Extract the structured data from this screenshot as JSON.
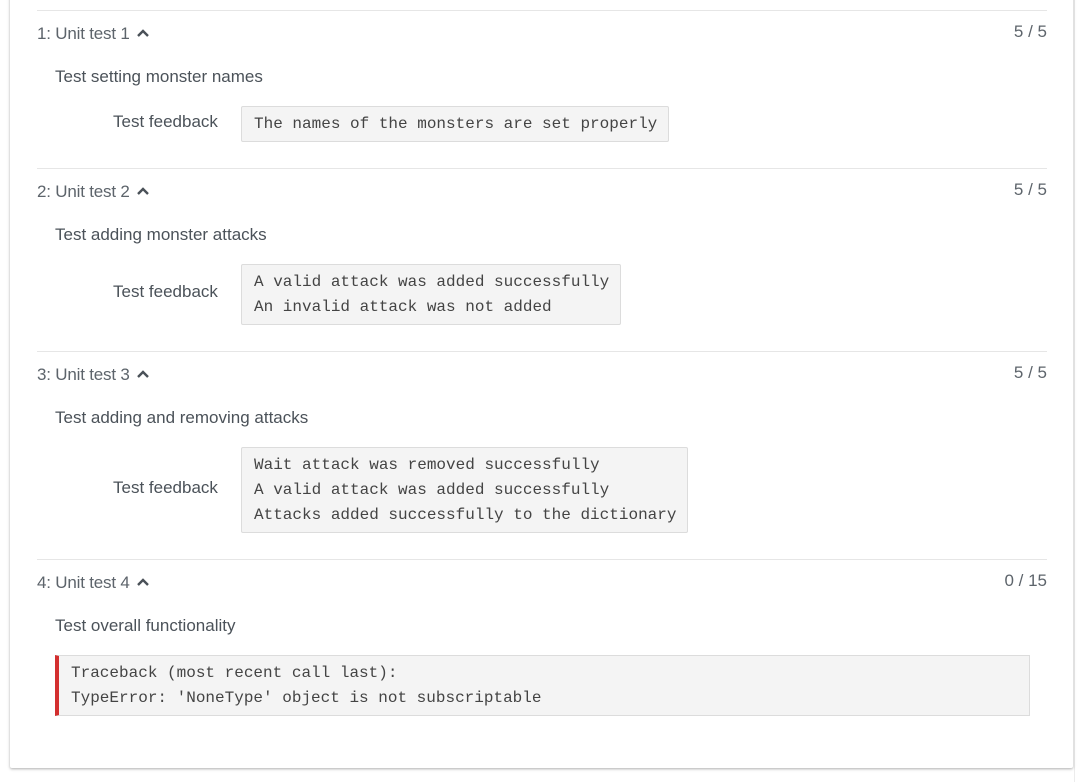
{
  "tests": [
    {
      "title": "1: Unit test 1",
      "score": "5 / 5",
      "description": "Test setting monster names",
      "feedback_label": "Test feedback",
      "feedback_lines": [
        "The names of the monsters are set properly"
      ]
    },
    {
      "title": "2: Unit test 2",
      "score": "5 / 5",
      "description": "Test adding monster attacks",
      "feedback_label": "Test feedback",
      "feedback_lines": [
        "A valid attack was added successfully",
        "An invalid attack was not added"
      ]
    },
    {
      "title": "3: Unit test 3",
      "score": "5 / 5",
      "description": "Test adding and removing attacks",
      "feedback_label": "Test feedback",
      "feedback_lines": [
        "Wait attack was removed successfully",
        "A valid attack was added successfully",
        "Attacks added successfully to the dictionary"
      ]
    },
    {
      "title": "4: Unit test 4",
      "score": "0 / 15",
      "description": "Test overall functionality",
      "error_lines": [
        "Traceback (most recent call last):",
        "TypeError: 'NoneType' object is not subscriptable"
      ]
    }
  ],
  "colors": {
    "error_accent": "#d32f2f",
    "text": "#5d646b",
    "code_bg": "#f4f4f4"
  },
  "icons": {
    "collapse": "chevron-up-icon"
  }
}
